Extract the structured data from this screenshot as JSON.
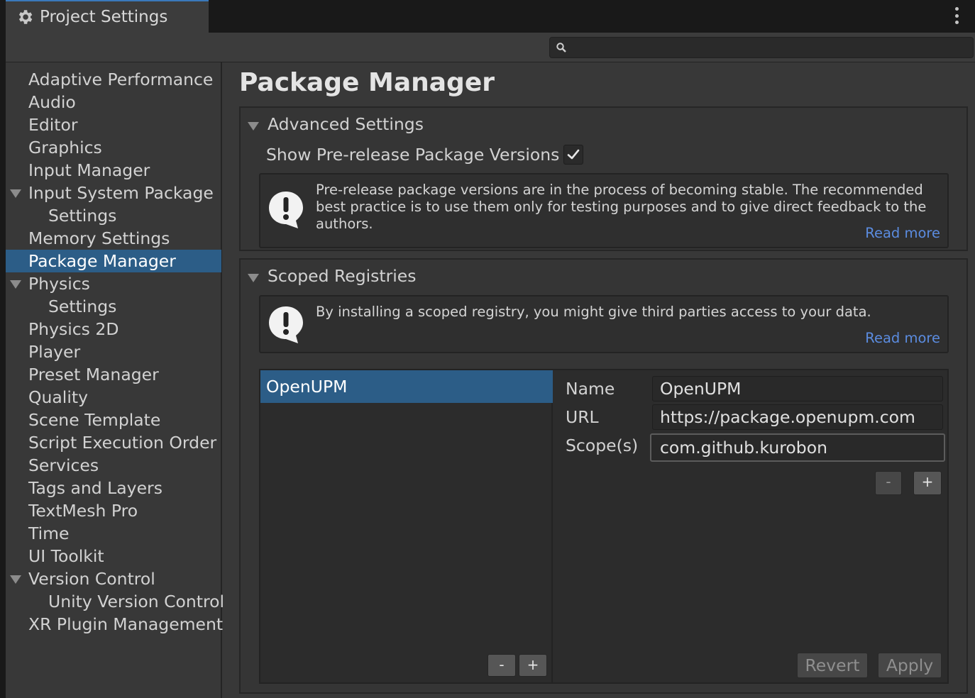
{
  "window": {
    "tab_title": "Project Settings",
    "tab_icon": "gear-icon",
    "menu_icon": "kebab-menu-icon"
  },
  "search": {
    "value": "",
    "placeholder": "",
    "icon": "search-icon"
  },
  "sidebar": {
    "items": [
      {
        "label": "Adaptive Performance"
      },
      {
        "label": "Audio"
      },
      {
        "label": "Editor"
      },
      {
        "label": "Graphics"
      },
      {
        "label": "Input Manager"
      },
      {
        "label": "Input System Package",
        "expanded": true
      },
      {
        "label": "Settings",
        "child": true
      },
      {
        "label": "Memory Settings"
      },
      {
        "label": "Package Manager",
        "selected": true
      },
      {
        "label": "Physics",
        "expanded": true
      },
      {
        "label": "Settings",
        "child": true
      },
      {
        "label": "Physics 2D"
      },
      {
        "label": "Player"
      },
      {
        "label": "Preset Manager"
      },
      {
        "label": "Quality"
      },
      {
        "label": "Scene Template"
      },
      {
        "label": "Script Execution Order"
      },
      {
        "label": "Services"
      },
      {
        "label": "Tags and Layers"
      },
      {
        "label": "TextMesh Pro"
      },
      {
        "label": "Time"
      },
      {
        "label": "UI Toolkit"
      },
      {
        "label": "Version Control",
        "expanded": true
      },
      {
        "label": "Unity Version Control",
        "child": true
      },
      {
        "label": "XR Plugin Management"
      }
    ]
  },
  "main": {
    "title": "Package Manager",
    "advanced": {
      "header": "Advanced Settings",
      "prerelease_label": "Show Pre-release Package Versions",
      "prerelease_checked": true,
      "help_text": "Pre-release package versions are in the process of becoming stable. The recommended best practice is to use them only for testing purposes and to give direct feedback to the authors.",
      "read_more": "Read more"
    },
    "scoped": {
      "header": "Scoped Registries",
      "help_text": "By installing a scoped registry, you might give third parties access to your data.",
      "read_more": "Read more",
      "registries": [
        "OpenUPM"
      ],
      "list_remove": "-",
      "list_add": "+",
      "name_label": "Name",
      "name_value": "OpenUPM",
      "url_label": "URL",
      "url_value": "https://package.openupm.com",
      "scopes_label": "Scope(s)",
      "scope_value": "com.github.kurobon",
      "scope_remove": "-",
      "scope_add": "+",
      "revert": "Revert",
      "apply": "Apply"
    }
  },
  "colors": {
    "selection": "#2c5d87",
    "link": "#5b8ce0",
    "panel": "#383838",
    "field": "#292929"
  }
}
